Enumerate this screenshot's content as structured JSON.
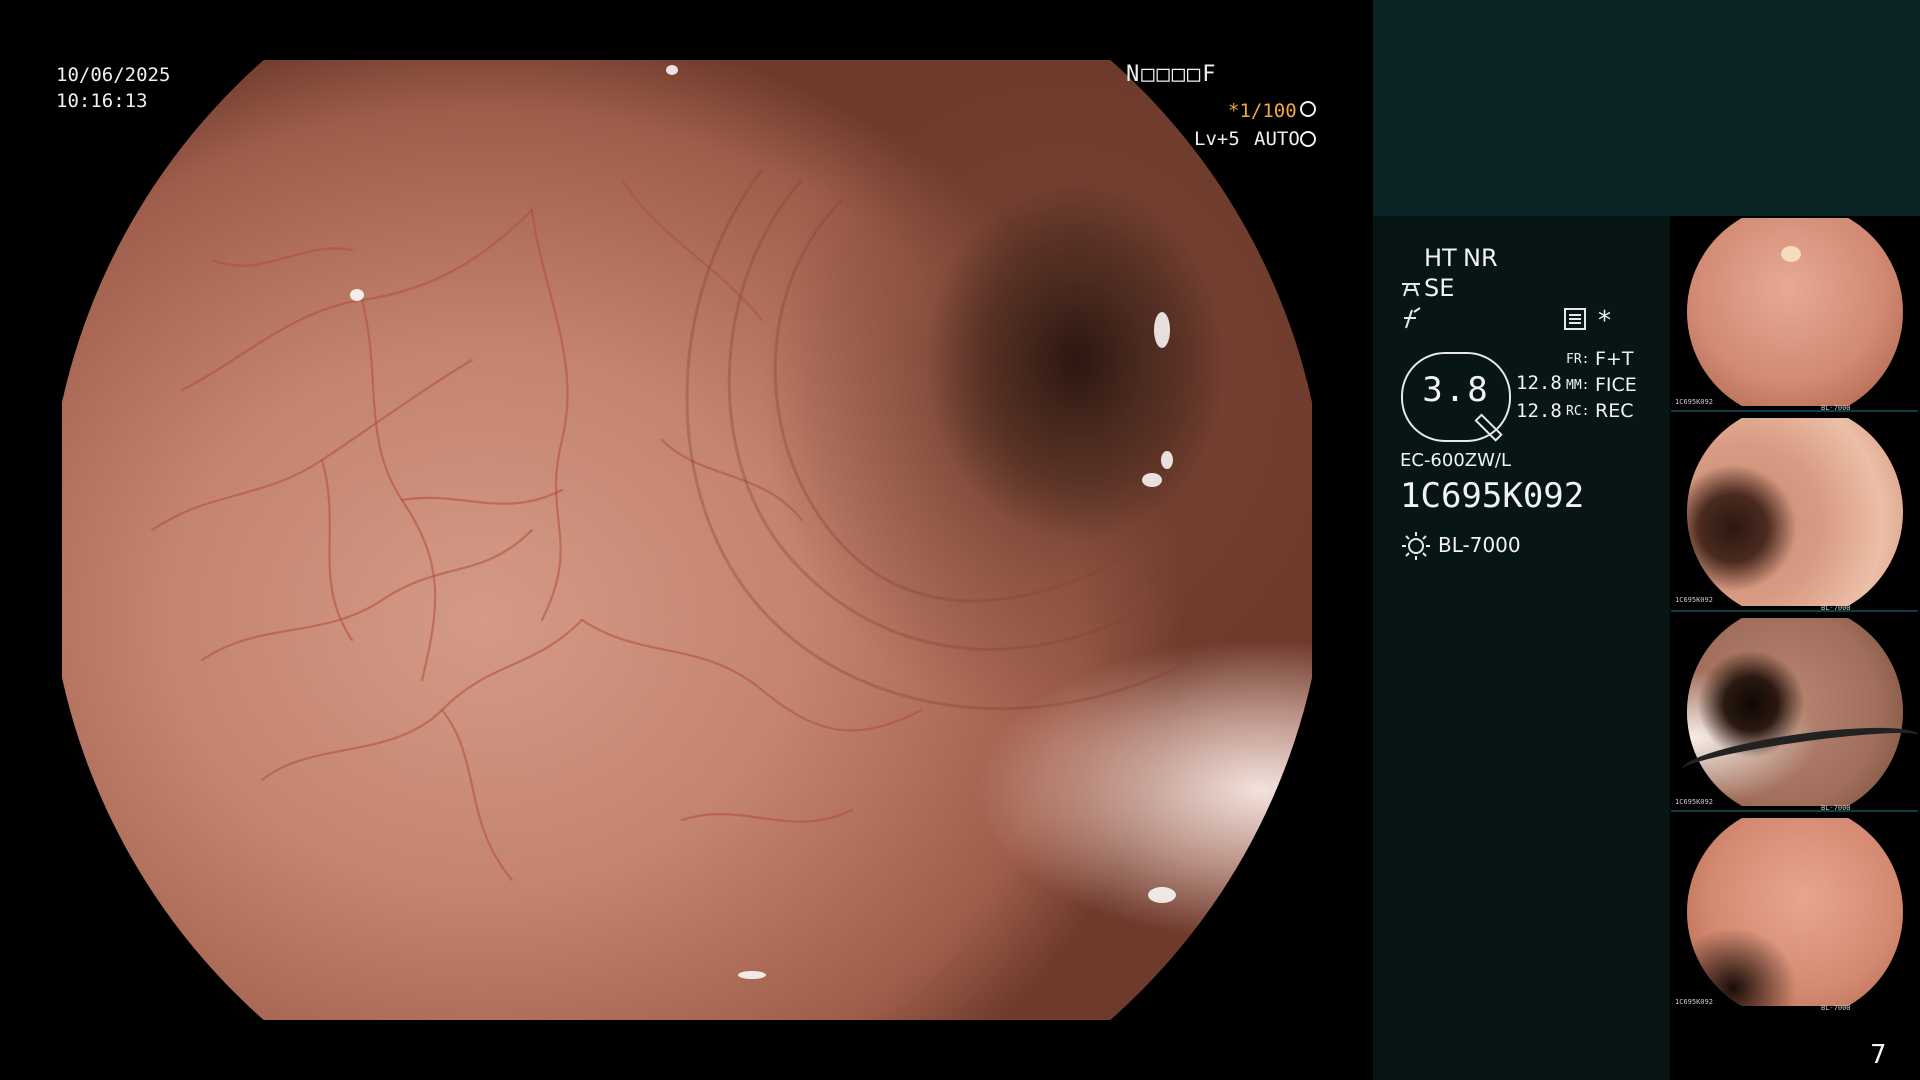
{
  "overlay": {
    "date": "10/06/2025",
    "time": "10:16:13",
    "patient_flags": "N□□□□F",
    "shutter": "*1/100",
    "level": "Lv+5",
    "mode": "AUTO"
  },
  "panel": {
    "ht": "HT",
    "nr": "NR",
    "se": "SE",
    "magnification": "3.8",
    "fr_label": "FR:",
    "fr_value": "F+T",
    "mm_label": "MM:",
    "mm_value": "FICE",
    "rc_label": "RC:",
    "rc_value": "REC",
    "val1": "12.8",
    "val2": "12.8",
    "scope_model": "EC-600ZW/L",
    "scope_serial": "1C695K092",
    "light_source": "BL-7000",
    "asterisk": "*"
  },
  "thumbnails": [
    {
      "id": "1",
      "serial": "1C695K092",
      "light": "BL-7000"
    },
    {
      "id": "2",
      "serial": "1C695K092",
      "light": "BL-7000"
    },
    {
      "id": "3",
      "serial": "1C695K092",
      "light": "BL-7000"
    },
    {
      "id": "4",
      "serial": "1C695K092",
      "light": "BL-7000"
    }
  ],
  "page_number": "7",
  "colors": {
    "accent_orange": "#f0a83c",
    "panel_top": "#0b2426",
    "panel_mid": "#071515"
  }
}
